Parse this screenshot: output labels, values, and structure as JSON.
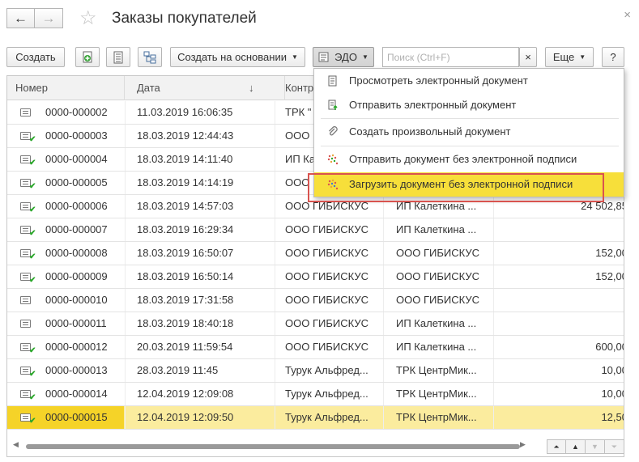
{
  "window": {
    "title": "Заказы покупателей",
    "back_glyph": "←",
    "forward_glyph": "→",
    "favorite_glyph": "☆",
    "close_glyph": "×"
  },
  "toolbar": {
    "create_label": "Создать",
    "create_based_label": "Создать на основании",
    "edo_label": "ЭДО",
    "search_placeholder": "Поиск (Ctrl+F)",
    "search_clear": "×",
    "more_label": "Еще",
    "help_label": "?"
  },
  "table": {
    "columns": {
      "number": "Номер",
      "date": "Дата",
      "contractor": "Контр",
      "sort_glyph": "↓"
    },
    "rows": [
      {
        "number": "0000-000002",
        "date": "11.03.2019 16:06:35",
        "contractor": "ТРК \"",
        "org": "",
        "sum": "",
        "posted": false
      },
      {
        "number": "0000-000003",
        "date": "18.03.2019 12:44:43",
        "contractor": "ООО",
        "org": "",
        "sum": "",
        "posted": true
      },
      {
        "number": "0000-000004",
        "date": "18.03.2019 14:11:40",
        "contractor": "ИП Ка",
        "org": "",
        "sum": "",
        "posted": true
      },
      {
        "number": "0000-000005",
        "date": "18.03.2019 14:14:19",
        "contractor": "ООО",
        "org": "",
        "sum": "",
        "posted": true
      },
      {
        "number": "0000-000006",
        "date": "18.03.2019 14:57:03",
        "contractor": "ООО ГИБИСКУС",
        "org": "ИП Калеткина ...",
        "sum": "24 502,85",
        "posted": true
      },
      {
        "number": "0000-000007",
        "date": "18.03.2019 16:29:34",
        "contractor": "ООО ГИБИСКУС",
        "org": "ИП Калеткина ...",
        "sum": "",
        "posted": true
      },
      {
        "number": "0000-000008",
        "date": "18.03.2019 16:50:07",
        "contractor": "ООО ГИБИСКУС",
        "org": "ООО ГИБИСКУС",
        "sum": "152,00",
        "posted": true
      },
      {
        "number": "0000-000009",
        "date": "18.03.2019 16:50:14",
        "contractor": "ООО ГИБИСКУС",
        "org": "ООО ГИБИСКУС",
        "sum": "152,00",
        "posted": true
      },
      {
        "number": "0000-000010",
        "date": "18.03.2019 17:31:58",
        "contractor": "ООО ГИБИСКУС",
        "org": "ООО ГИБИСКУС",
        "sum": "",
        "posted": false
      },
      {
        "number": "0000-000011",
        "date": "18.03.2019 18:40:18",
        "contractor": "ООО ГИБИСКУС",
        "org": "ИП Калеткина ...",
        "sum": "",
        "posted": false
      },
      {
        "number": "0000-000012",
        "date": "20.03.2019 11:59:54",
        "contractor": "ООО ГИБИСКУС",
        "org": "ИП Калеткина ...",
        "sum": "600,00",
        "posted": true
      },
      {
        "number": "0000-000013",
        "date": "28.03.2019 11:45",
        "contractor": "Турук Альфред...",
        "org": "ТРК ЦентрМик...",
        "sum": "10,00",
        "posted": true
      },
      {
        "number": "0000-000014",
        "date": "12.04.2019 12:09:08",
        "contractor": "Турук Альфред...",
        "org": "ТРК ЦентрМик...",
        "sum": "10,00",
        "posted": true
      },
      {
        "number": "0000-000015",
        "date": "12.04.2019 12:09:50",
        "contractor": "Турук Альфред...",
        "org": "ТРК ЦентрМик...",
        "sum": "12,50",
        "posted": true,
        "selected": true
      }
    ]
  },
  "edo_menu": {
    "items": [
      {
        "label": "Просмотреть электронный документ",
        "icon": "doc-view-icon"
      },
      {
        "label": "Отправить электронный документ",
        "icon": "doc-send-icon"
      },
      {
        "label": "Создать произвольный документ",
        "icon": "paperclip-icon"
      },
      {
        "label": "Отправить документ без электронной подписи",
        "icon": "send-unsigned-icon"
      },
      {
        "label": "Загрузить документ без электронной подписи",
        "icon": "load-unsigned-icon",
        "highlighted": true
      }
    ]
  },
  "colors": {
    "highlight": "#f7df3a",
    "selected_row": "#fbec9e",
    "annotation_box": "#d9534f",
    "posted_check": "#2aa62a"
  }
}
